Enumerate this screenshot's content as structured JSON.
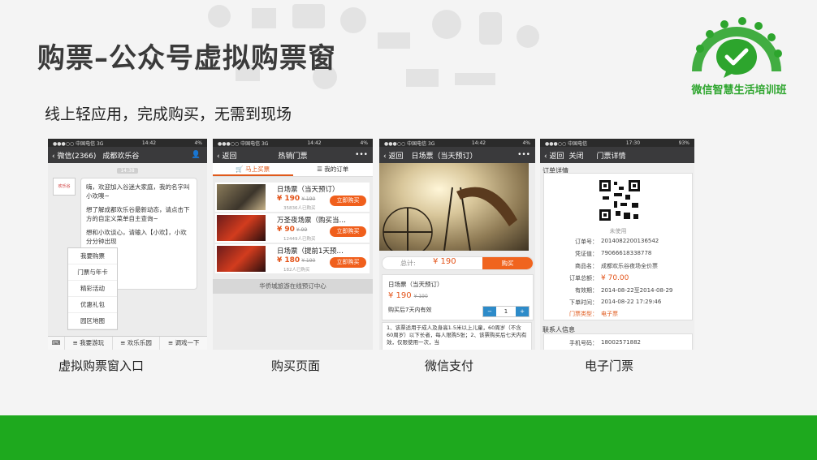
{
  "page": {
    "title": "购票–公众号虚拟购票窗",
    "subtitle": "线上轻应用，完成购买，无需到现场",
    "logo_text": "微信智慧生活培训班",
    "captions": [
      "虚拟购票窗入口",
      "购买页面",
      "微信支付",
      "电子门票"
    ]
  },
  "phone1": {
    "status": {
      "left": "●●●○○ 中国电信 3G",
      "time": "14:42",
      "right": "4%"
    },
    "nav": {
      "back": "微信(2366)",
      "title": "成都欢乐谷"
    },
    "timestamp": "14:38",
    "avatar_text": "欢乐谷",
    "bubble": [
      "嗨，欢迎加入谷迷大家庭，我的名字叫小欢噢~",
      "想了解成都欢乐谷最新动态，请点击下方的自定义菜单自主查询~",
      "想和小欢谈心，请输入【小欢】，小欢分分钟出现"
    ],
    "menu": [
      "我要购票",
      "门票与年卡",
      "精彩活动",
      "优惠礼包",
      "园区地图"
    ],
    "bottom": [
      "≡ 我要游玩",
      "≡ 欢乐乐园",
      "≡ 调戏一下"
    ]
  },
  "phone2": {
    "status": {
      "left": "●●●○○ 中国电信 3G",
      "time": "14:42",
      "right": "4%"
    },
    "nav": {
      "back": "返回",
      "title": "热销门票",
      "more": "•••"
    },
    "tabs": [
      "马上买票",
      "我的订单"
    ],
    "items": [
      {
        "name": "日场票（当天预订）",
        "price": "¥ 190",
        "old": "¥ 190",
        "sold": "35836人已购买",
        "button": "立即购买"
      },
      {
        "name": "万圣夜场票（购买当…",
        "price": "¥ 90",
        "old": "¥ 99",
        "sold": "12449人已购买",
        "button": "立即购买"
      },
      {
        "name": "日场票（提前1天预…",
        "price": "¥ 180",
        "old": "¥ 190",
        "sold": "182人已购买",
        "button": "立即购买"
      }
    ],
    "footer": "华侨城旅游在线预订中心"
  },
  "phone3": {
    "status": {
      "left": "●●●○○ 中国电信 3G",
      "time": "14:42",
      "right": "4%"
    },
    "nav": {
      "back": "返回",
      "title": "日场票（当天预订）",
      "more": "•••"
    },
    "total_label": "总计:",
    "total_amount": "¥ 190",
    "buy_button": "购买",
    "detail_name": "日场票（当天预订）",
    "detail_price": "¥ 190",
    "detail_old": "¥ 190",
    "detail_note": "购买后7天内有效",
    "quantity": "1",
    "rules": "1、该票适用于成人及身高1.5米以上儿童，60周岁（不含60周岁）以下长者，每人限购5张；2、该票购买后七天内有效，仅限使用一次，当"
  },
  "phone4": {
    "status": {
      "left": "●●●○○ 中国电信",
      "time": "17:30",
      "right": "93%"
    },
    "nav": {
      "back": "返回",
      "close": "关闭",
      "title": "门票详情"
    },
    "section_order": "订单详情",
    "used": "未使用",
    "rows": [
      {
        "k": "订单号：",
        "v": "2014082200136542"
      },
      {
        "k": "凭证值：",
        "v": "79066618338778"
      },
      {
        "k": "商品名：",
        "v": "成都欢乐谷夜场全价票"
      },
      {
        "k": "订单总额：",
        "v": "¥ 70.00"
      },
      {
        "k": "有效期：",
        "v": "2014-08-22至2014-08-29"
      },
      {
        "k": "下单时间：",
        "v": "2014-08-22 17:29:46"
      },
      {
        "k": "门票类型：",
        "v": "电子票"
      }
    ],
    "section_contact": "联系人信息",
    "contact": {
      "k": "手机号码：",
      "v": "18002571882"
    }
  },
  "colors": {
    "brand_green": "#1ea91e",
    "accent_orange": "#f05f1c"
  }
}
